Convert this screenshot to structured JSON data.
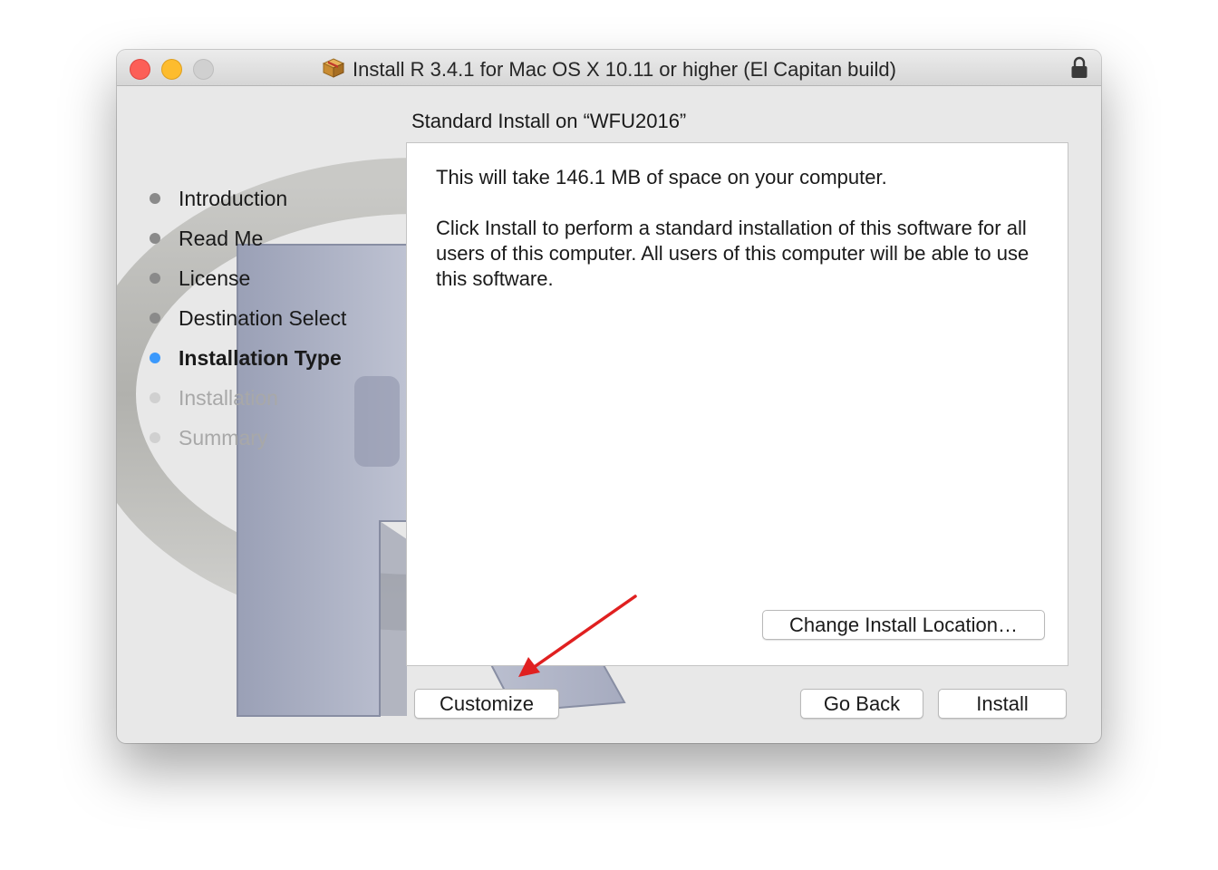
{
  "window": {
    "title": "Install R 3.4.1 for Mac OS X 10.11 or higher (El Capitan build)"
  },
  "header": {
    "subtitle": "Standard Install on “WFU2016”"
  },
  "sidebar": {
    "steps": [
      {
        "label": "Introduction",
        "state": "done"
      },
      {
        "label": "Read Me",
        "state": "done"
      },
      {
        "label": "License",
        "state": "done"
      },
      {
        "label": "Destination Select",
        "state": "done"
      },
      {
        "label": "Installation Type",
        "state": "current"
      },
      {
        "label": "Installation",
        "state": "pending"
      },
      {
        "label": "Summary",
        "state": "pending"
      }
    ]
  },
  "panel": {
    "space_text": "This will take 146.1 MB of space on your computer.",
    "description": "Click Install to perform a standard installation of this software for all users of this computer. All users of this computer will be able to use this software.",
    "change_location_label": "Change Install Location…"
  },
  "buttons": {
    "customize": "Customize",
    "go_back": "Go Back",
    "install": "Install"
  },
  "colors": {
    "current_step_dot": "#3b99fc",
    "annotation_arrow": "#e02020",
    "close_light": "#fc5f57",
    "minimize_light": "#fdbc2e"
  },
  "icons": [
    "package-icon",
    "lock-icon",
    "r-logo-background",
    "red-arrow-annotation"
  ]
}
